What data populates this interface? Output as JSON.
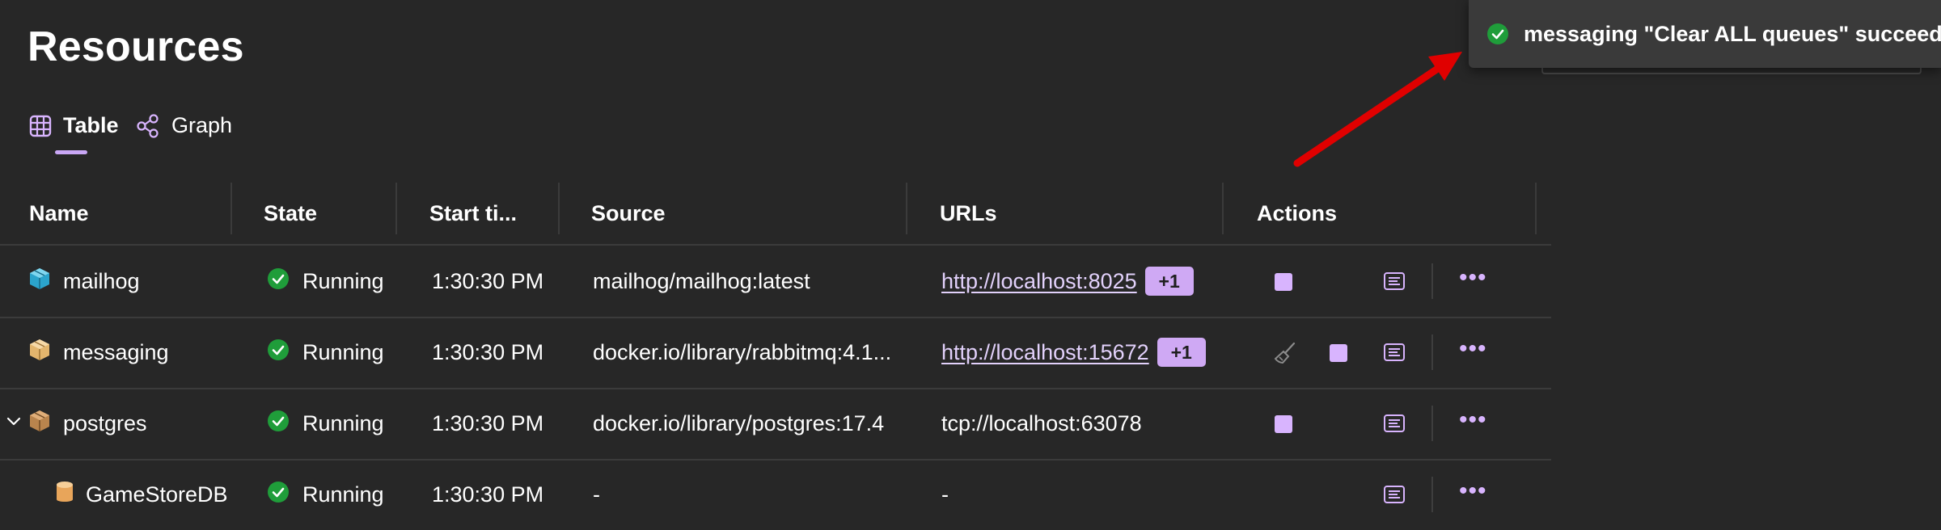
{
  "page": {
    "title": "Resources"
  },
  "view_tabs": [
    {
      "label": "Table",
      "icon": "table-icon",
      "selected": true
    },
    {
      "label": "Graph",
      "icon": "graph-icon",
      "selected": false
    }
  ],
  "table": {
    "columns": [
      "Name",
      "State",
      "Start ti...",
      "Source",
      "URLs",
      "Actions"
    ],
    "rows": [
      {
        "name": "mailhog",
        "icon": "container-icon",
        "state": "Running",
        "start": "1:30:30 PM",
        "source": "mailhog/mailhog:latest",
        "url": "http://localhost:8025",
        "url_extra": "+1",
        "has_clear": false,
        "has_stop": true
      },
      {
        "name": "messaging",
        "icon": "container-icon",
        "state": "Running",
        "start": "1:30:30 PM",
        "source": "docker.io/library/rabbitmq:4.1...",
        "url": "http://localhost:15672",
        "url_extra": "+1",
        "has_clear": true,
        "has_stop": true
      },
      {
        "name": "postgres",
        "icon": "container-icon",
        "state": "Running",
        "start": "1:30:30 PM",
        "source": "docker.io/library/postgres:17.4",
        "url": "tcp://localhost:63078",
        "url_extra": "",
        "has_clear": false,
        "has_stop": true
      },
      {
        "name": "GameStoreDB",
        "icon": "database-icon",
        "state": "Running",
        "start": "1:30:30 PM",
        "source": "-",
        "url": "-",
        "url_extra": "",
        "has_clear": false,
        "has_stop": false
      }
    ]
  },
  "toast": {
    "message": "messaging \"Clear ALL queues\" succeeded",
    "icon": "success-check-icon"
  },
  "colors": {
    "accent": "#d8b4fe",
    "success": "#1f9d3a",
    "background": "#272727",
    "arrow": "#e00000"
  }
}
